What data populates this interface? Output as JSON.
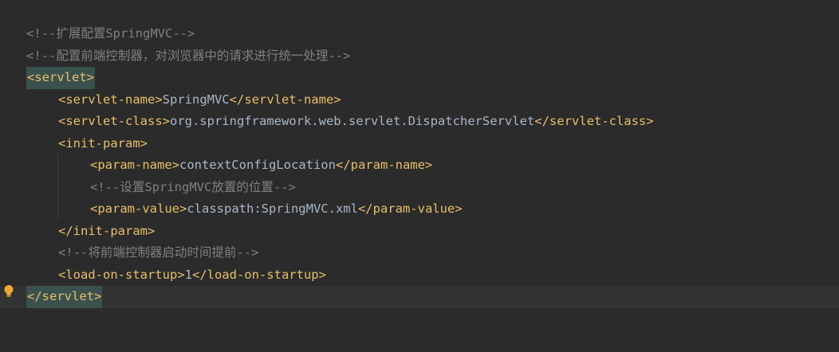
{
  "editor": {
    "colors": {
      "background": "#2b2b2b",
      "tag": "#e8bf6a",
      "text": "#a9b7c6",
      "comment": "#808080",
      "match_highlight": "#3b514d",
      "current_line": "#323232"
    },
    "gutter_icon": "lightbulb-icon",
    "lines": {
      "l1": "<!--扩展配置SpringMVC-->",
      "l2": "<!--配置前端控制器，对浏览器中的请求进行统一处理-->",
      "l3": "<servlet>",
      "l4_open": "<servlet-name>",
      "l4_text": "SpringMVC",
      "l4_close": "</servlet-name>",
      "l5_open": "<servlet-class>",
      "l5_text": "org.springframework.web.servlet.DispatcherServlet",
      "l5_close": "</servlet-class>",
      "l6": "<init-param>",
      "l7_open": "<param-name>",
      "l7_text": "contextConfigLocation",
      "l7_close": "</param-name>",
      "l8": "<!--设置SpringMVC放置的位置-->",
      "l9_open": "<param-value>",
      "l9_text": "classpath:SpringMVC.xml",
      "l9_close": "</param-value>",
      "l10": "</init-param>",
      "l11": "<!--将前端控制器启动时间提前-->",
      "l12_open": "<load-on-startup>",
      "l12_text": "1",
      "l12_close": "</load-on-startup>",
      "l13": "</servlet>"
    }
  }
}
